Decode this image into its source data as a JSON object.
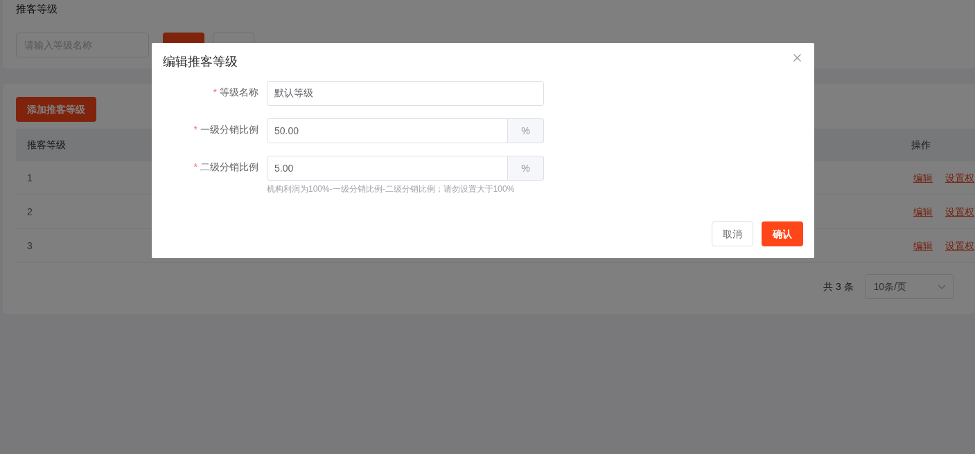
{
  "page": {
    "title": "推客等级",
    "search": {
      "placeholder": "请输入等级名称"
    }
  },
  "toolbar": {
    "add_button": "添加推客等级"
  },
  "table": {
    "columns": [
      "推客等级",
      "操作"
    ],
    "rows": [
      {
        "level": "1",
        "actions": [
          "编辑",
          "设置权"
        ]
      },
      {
        "level": "2",
        "actions": [
          "编辑",
          "设置权"
        ]
      },
      {
        "level": "3",
        "actions": [
          "编辑",
          "设置权"
        ]
      }
    ]
  },
  "pagination": {
    "total": "共 3 条",
    "page_size": "10条/页"
  },
  "dialog": {
    "title": "编辑推客等级",
    "fields": [
      {
        "label": "等级名称",
        "required_mark": "*",
        "value": "默认等级"
      },
      {
        "label": "一级分销比例",
        "required_mark": "*",
        "value": "50.00",
        "suffix": "%"
      },
      {
        "label": "二级分销比例",
        "required_mark": "*",
        "value": "5.00",
        "suffix": "%",
        "hint": "机构利润为100%-一级分销比例-二级分销比例；请勿设置大于100%"
      }
    ],
    "buttons": [
      {
        "label": "取消",
        "kind": "default"
      },
      {
        "label": "确认",
        "kind": "primary"
      }
    ]
  }
}
